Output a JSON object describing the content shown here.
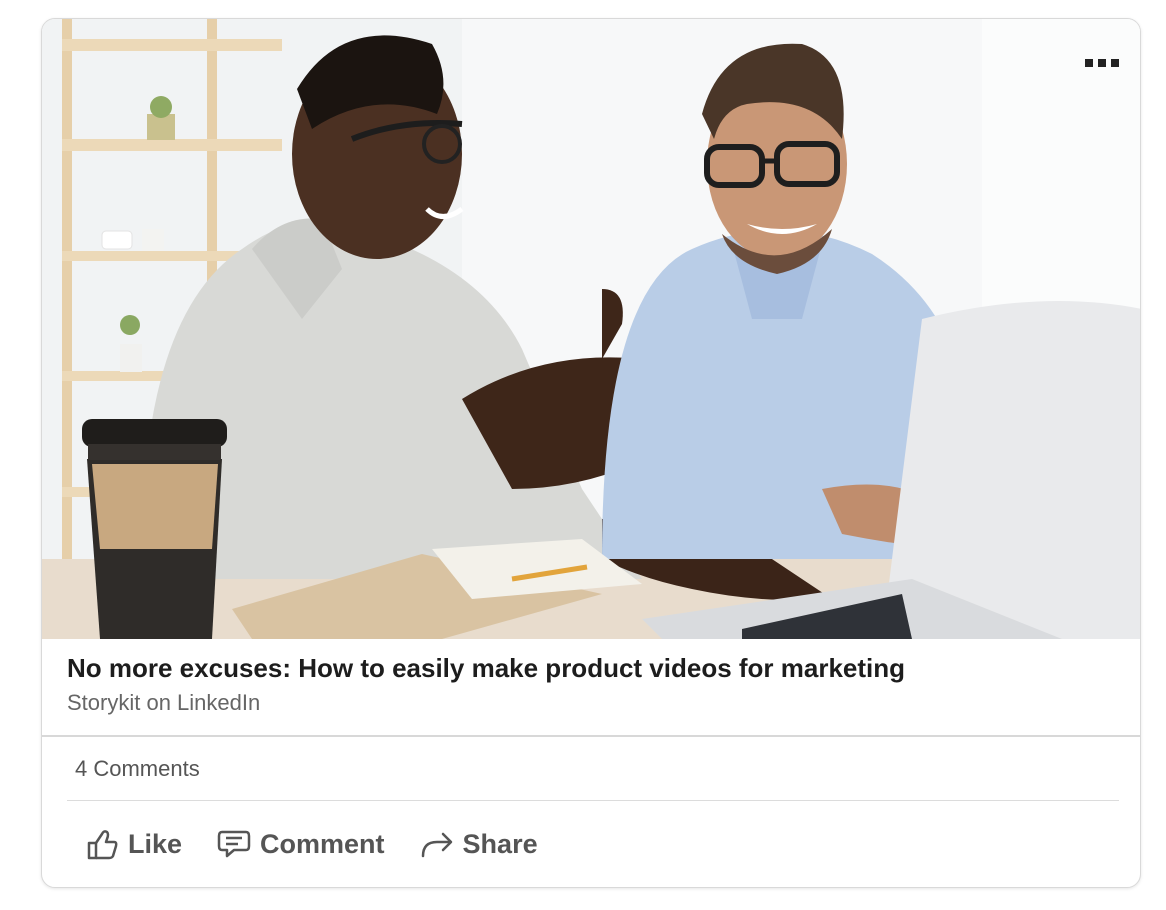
{
  "post": {
    "title": "No more excuses: How to easily make product videos for marketing",
    "source": "Storykit on LinkedIn",
    "image_alt": "Two men smiling and looking at a laptop",
    "comments_count": "4 Comments"
  },
  "actions": {
    "like_label": "Like",
    "comment_label": "Comment",
    "share_label": "Share"
  },
  "icons": {
    "more": "more-options-icon",
    "like": "thumbs-up-icon",
    "comment": "comment-bubble-icon",
    "share": "share-arrow-icon"
  },
  "colors": {
    "text_primary": "#1d1d1d",
    "text_secondary": "#666666",
    "border": "#d9d9d9"
  }
}
